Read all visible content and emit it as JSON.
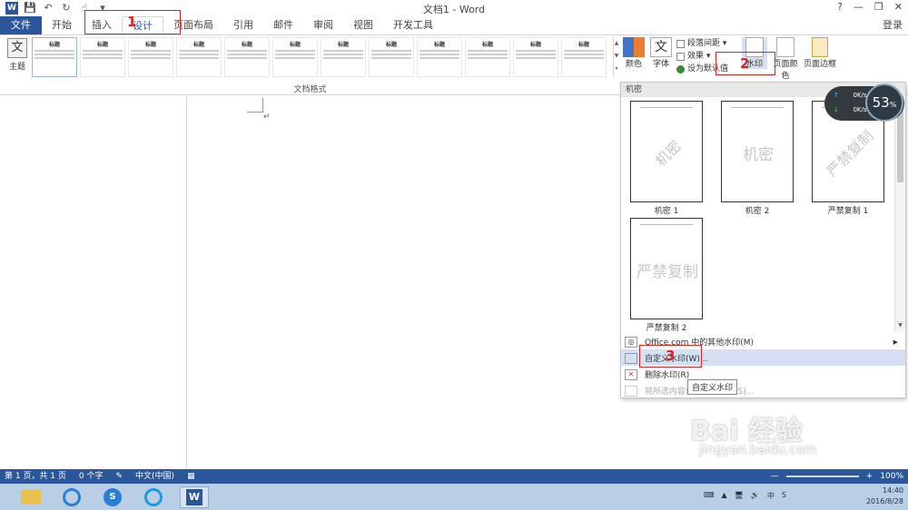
{
  "window": {
    "title": "文档1 - Word",
    "help": "?",
    "minimize": "—",
    "restore": "❐",
    "close": "✕"
  },
  "qat": {
    "app_icon": "W",
    "save": "💾",
    "undo": "↶",
    "redo": "↻",
    "touch": "☝",
    "more": "▾"
  },
  "tabs": [
    "文件",
    "开始",
    "插入",
    "设计",
    "页面布局",
    "引用",
    "邮件",
    "审阅",
    "视图",
    "开发工具"
  ],
  "active_tab_index": 3,
  "login": "登录",
  "ribbon": {
    "theme_label": "主题",
    "theme_icon": "文",
    "style_thumbs": [
      "标题",
      "标题",
      "标题",
      "标题",
      "标题",
      "标题",
      "标题",
      "标题",
      "标题",
      "标题",
      "标题",
      "标题"
    ],
    "style_group_label": "文档格式",
    "colors_label": "颜色",
    "fonts_label": "字体",
    "fonts_icon": "文",
    "paragraph_spacing": "段落间距 ▾",
    "effects": "效果 ▾",
    "set_default": "设为默认值",
    "watermark_label": "水印",
    "page_color_label": "页面颜色",
    "page_border_label": "页面边框"
  },
  "annotations": {
    "one": "1",
    "two": "2",
    "three": "3"
  },
  "document": {
    "para_mark": "↵"
  },
  "watermark_menu": {
    "header": "机密",
    "items": [
      {
        "label": "机密 1",
        "text": "机密"
      },
      {
        "label": "机密 2",
        "text": "机密"
      },
      {
        "label": "严禁复制 1",
        "text": "严禁复制"
      },
      {
        "label": "严禁复制 2",
        "text": "严禁复制"
      }
    ],
    "more_online": "Office.com 中的其他水印(M)",
    "custom": "自定义水印(W)...",
    "remove": "删除水印(R)",
    "save_selection": "将所选内容保存到水印库(S)..."
  },
  "tooltip": "自定义水印",
  "net_widget": {
    "up": "0K/s",
    "down": "0K/s",
    "percent": "53",
    "percent_unit": "%"
  },
  "statusbar": {
    "page": "第 1 页，共 1 页",
    "words": "0 个字",
    "lang": "中文(中国)",
    "zoom": "100%"
  },
  "taskbar": {
    "clock_time": "14:40",
    "clock_date": "2016/8/28",
    "tray": [
      "⌨",
      "▲",
      "🖥",
      "🔊",
      "中",
      "S"
    ]
  },
  "overlay": {
    "brand": "Bai 经验",
    "url": "jingyan.baidu.com"
  },
  "colors": {
    "accent": "#2b579a",
    "annotation": "#dd2222",
    "highlight": "#d5e1f2"
  }
}
